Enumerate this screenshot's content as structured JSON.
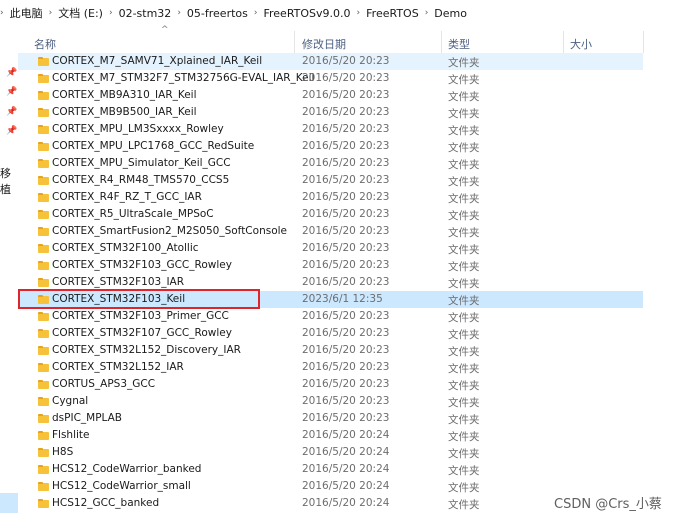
{
  "breadcrumb": [
    "此电脑",
    "文档 (E:)",
    "02-stm32",
    "05-freertos",
    "FreeRTOSv9.0.0",
    "FreeRTOS",
    "Demo"
  ],
  "nav": {
    "label": "移植"
  },
  "columns": {
    "name": "名称",
    "modified": "修改日期",
    "type": "类型",
    "size": "大小"
  },
  "files": [
    {
      "name": "CORTEX_M7_SAMV71_Xplained_IAR_Keil",
      "modified": "2016/5/20 20:23",
      "type": "文件夹",
      "state": "hover"
    },
    {
      "name": "CORTEX_M7_STM32F7_STM32756G-EVAL_IAR_Keil",
      "modified": "2016/5/20 20:23",
      "type": "文件夹"
    },
    {
      "name": "CORTEX_MB9A310_IAR_Keil",
      "modified": "2016/5/20 20:23",
      "type": "文件夹"
    },
    {
      "name": "CORTEX_MB9B500_IAR_Keil",
      "modified": "2016/5/20 20:23",
      "type": "文件夹"
    },
    {
      "name": "CORTEX_MPU_LM3Sxxxx_Rowley",
      "modified": "2016/5/20 20:23",
      "type": "文件夹"
    },
    {
      "name": "CORTEX_MPU_LPC1768_GCC_RedSuite",
      "modified": "2016/5/20 20:23",
      "type": "文件夹"
    },
    {
      "name": "CORTEX_MPU_Simulator_Keil_GCC",
      "modified": "2016/5/20 20:23",
      "type": "文件夹"
    },
    {
      "name": "CORTEX_R4_RM48_TMS570_CCS5",
      "modified": "2016/5/20 20:23",
      "type": "文件夹"
    },
    {
      "name": "CORTEX_R4F_RZ_T_GCC_IAR",
      "modified": "2016/5/20 20:23",
      "type": "文件夹"
    },
    {
      "name": "CORTEX_R5_UltraScale_MPSoC",
      "modified": "2016/5/20 20:23",
      "type": "文件夹"
    },
    {
      "name": "CORTEX_SmartFusion2_M2S050_SoftConsole",
      "modified": "2016/5/20 20:23",
      "type": "文件夹"
    },
    {
      "name": "CORTEX_STM32F100_Atollic",
      "modified": "2016/5/20 20:23",
      "type": "文件夹"
    },
    {
      "name": "CORTEX_STM32F103_GCC_Rowley",
      "modified": "2016/5/20 20:23",
      "type": "文件夹"
    },
    {
      "name": "CORTEX_STM32F103_IAR",
      "modified": "2016/5/20 20:23",
      "type": "文件夹"
    },
    {
      "name": "CORTEX_STM32F103_Keil",
      "modified": "2023/6/1 12:35",
      "type": "文件夹",
      "state": "selected"
    },
    {
      "name": "CORTEX_STM32F103_Primer_GCC",
      "modified": "2016/5/20 20:23",
      "type": "文件夹"
    },
    {
      "name": "CORTEX_STM32F107_GCC_Rowley",
      "modified": "2016/5/20 20:23",
      "type": "文件夹"
    },
    {
      "name": "CORTEX_STM32L152_Discovery_IAR",
      "modified": "2016/5/20 20:23",
      "type": "文件夹"
    },
    {
      "name": "CORTEX_STM32L152_IAR",
      "modified": "2016/5/20 20:23",
      "type": "文件夹"
    },
    {
      "name": "CORTUS_APS3_GCC",
      "modified": "2016/5/20 20:23",
      "type": "文件夹"
    },
    {
      "name": "Cygnal",
      "modified": "2016/5/20 20:23",
      "type": "文件夹"
    },
    {
      "name": "dsPIC_MPLAB",
      "modified": "2016/5/20 20:23",
      "type": "文件夹"
    },
    {
      "name": "Flshlite",
      "modified": "2016/5/20 20:24",
      "type": "文件夹"
    },
    {
      "name": "H8S",
      "modified": "2016/5/20 20:24",
      "type": "文件夹"
    },
    {
      "name": "HCS12_CodeWarrior_banked",
      "modified": "2016/5/20 20:24",
      "type": "文件夹"
    },
    {
      "name": "HCS12_CodeWarrior_small",
      "modified": "2016/5/20 20:24",
      "type": "文件夹"
    },
    {
      "name": "HCS12_GCC_banked",
      "modified": "2016/5/20 20:24",
      "type": "文件夹"
    }
  ],
  "watermark": "CSDN @Crs_小蔡",
  "colors": {
    "selected": "#cce8ff",
    "hover": "#e5f3ff",
    "highlight_box": "#e0242b",
    "folder": "#f5c23a"
  }
}
